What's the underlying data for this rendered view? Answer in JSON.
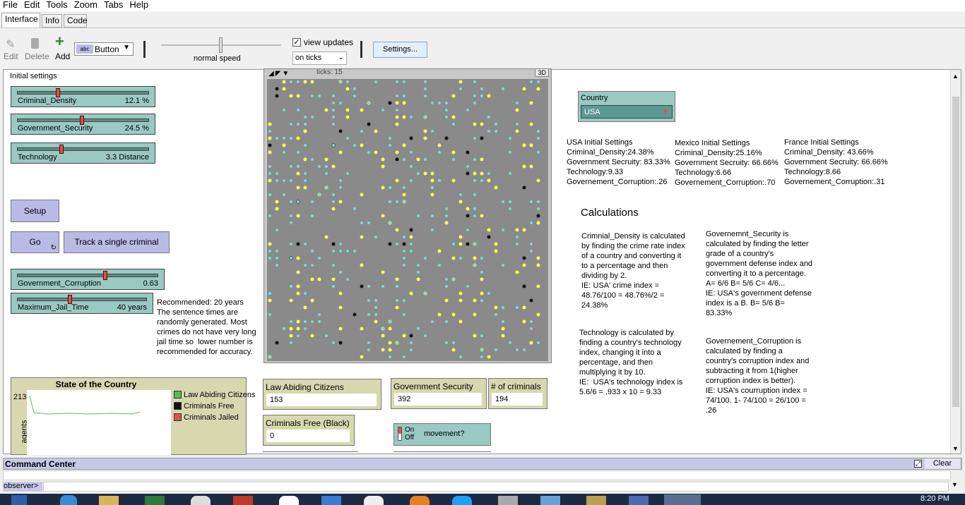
{
  "menu": [
    "File",
    "Edit",
    "Tools",
    "Zoom",
    "Tabs",
    "Help"
  ],
  "tabs": [
    "Interface",
    "Info",
    "Code"
  ],
  "toolbar": {
    "edit": "Edit",
    "delete": "Delete",
    "add": "Add",
    "widget_type": "Button",
    "speed": "normal speed",
    "view_updates": "view updates",
    "update_mode": "on ticks",
    "settings": "Settings..."
  },
  "panel": {
    "initial_settings": "Initial settings"
  },
  "sliders": {
    "criminal_density": {
      "name": "Criminal_Density",
      "value": "12.1 %"
    },
    "government_security": {
      "name": "Government_Security",
      "value": "24.5 %"
    },
    "technology": {
      "name": "Technology",
      "value": "3.3 Distance"
    },
    "government_corruption": {
      "name": "Government_Corruption",
      "value": "0.63"
    },
    "max_jail": {
      "name": "Maximum_Jail_Time",
      "value": "40 years"
    }
  },
  "buttons": {
    "setup": "Setup",
    "go": "Go",
    "track": "Track a single criminal"
  },
  "jail_note": "Recommended: 20 years\nThe sentence times are randomly generated. Most crimes do not have very long jail time so  lower number is recommended for accuracy.",
  "view": {
    "ticks": "ticks: 15",
    "threed": "3D"
  },
  "plot": {
    "title": "State of the Country",
    "ymax": "213",
    "ylabel": "agents",
    "legend": [
      {
        "label": "Law Abiding Citizens",
        "color": "#5cb85c"
      },
      {
        "label": "Criminals Free",
        "color": "#111111"
      },
      {
        "label": "Criminals Jailed",
        "color": "#d9534f"
      }
    ]
  },
  "monitors": {
    "law": {
      "label": "Law Abiding Citizens",
      "value": "153"
    },
    "gov": {
      "label": "Government Security",
      "value": "392"
    },
    "crim": {
      "label": "# of criminals",
      "value": "194"
    },
    "free": {
      "label": "Criminals Free (Black)",
      "value": "0"
    }
  },
  "switch": {
    "on": "On",
    "off": "Off",
    "label": "movement?"
  },
  "chooser": {
    "label": "Country",
    "value": "USA"
  },
  "usa": {
    "title": "USA Initial Settings",
    "l1": "Criminal_Density:24.38%",
    "l2": "Government Secruity: 83.33%",
    "l3": "Technology:9.33",
    "l4": "Governement_Corruption:.26"
  },
  "mexico": {
    "title": "Mexico Initial Settings",
    "l1": "Criminal_Density:25.16%",
    "l2": "Government Secruity: 66.66%",
    "l3": "Technology:6.66",
    "l4": "Governement_Corruption:.70"
  },
  "france": {
    "title": "France Initial Settings",
    "l1": "Criminal_Density: 43.66%",
    "l2": "Government Secruity: 66.66%",
    "l3": "Technology:8.66",
    "l4": "Governement_Corruption:.31"
  },
  "calc": {
    "title": "Calculations",
    "density": "Crimnial_Density is calculated by finding the crime rate index of a country and converting it to a percentage and then dividing by 2.\nIE: USA' crime index = 48.76/100 = 48.76%/2 = 24.38%",
    "security": "Governemnt_Security is calculated by finding the letter grade of a country's government defense index and converting it to a percentage. A= 6/6 B= 5/6 C= 4/6...\nIE: USA's government defense index is a B. B= 5/6 B= 83.33%",
    "technology": "Technology is calculated by finding a country's technology index, changing it into a percentage, and then multiplying it by 10.\nIE:  USA's technology index is 5.6/6 = .933 x 10 = 9.33",
    "corruption": "Governement_Corruption is calculated by finding a country's corruption index and subtracting it from 1(higher corruption index is better).\nIE: USA's courruption index = 74/100. 1- 74/100 = 26/100 = .26"
  },
  "command": {
    "title": "Command Center",
    "clear": "Clear",
    "prompt": "observer>"
  },
  "clock": "8:20 PM",
  "levels": {
    "criminal_density": 0.3,
    "government_security": 0.49,
    "technology": 0.33,
    "government_corruption": 0.63,
    "max_jail": 0.4,
    "speed": 0.5
  }
}
